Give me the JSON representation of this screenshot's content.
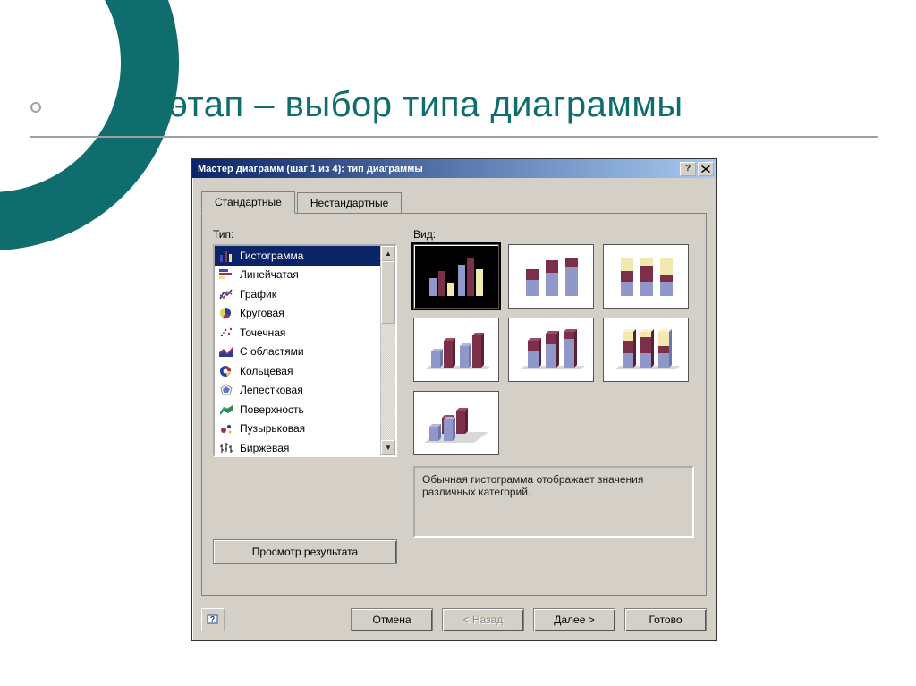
{
  "slide": {
    "title": "1 этап – выбор типа диаграммы"
  },
  "dialog": {
    "title": "Мастер диаграмм (шаг 1 из 4): тип диаграммы",
    "tabs": {
      "standard": "Стандартные",
      "custom": "Нестандартные"
    },
    "labels": {
      "type": "Тип:",
      "view": "Вид:"
    },
    "preview_btn": "Просмотр результата",
    "description": "Обычная гистограмма отображает значения различных категорий.",
    "types": [
      {
        "label": "Гистограмма",
        "icon": "bar"
      },
      {
        "label": "Линейчатая",
        "icon": "hbar"
      },
      {
        "label": "График",
        "icon": "line"
      },
      {
        "label": "Круговая",
        "icon": "pie"
      },
      {
        "label": "Точечная",
        "icon": "scatter"
      },
      {
        "label": "С областями",
        "icon": "area"
      },
      {
        "label": "Кольцевая",
        "icon": "donut"
      },
      {
        "label": "Лепестковая",
        "icon": "radar"
      },
      {
        "label": "Поверхность",
        "icon": "surface"
      },
      {
        "label": "Пузырьковая",
        "icon": "bubble"
      },
      {
        "label": "Биржевая",
        "icon": "stock"
      }
    ],
    "selected_type_index": 0,
    "buttons": {
      "cancel": "Отмена",
      "back": "< Назад",
      "next": "Далее >",
      "finish": "Готово"
    }
  },
  "colors": {
    "accent": "#0f6d6e",
    "sel_bg": "#0b2468",
    "bar1": "#8f98c9",
    "bar2": "#7b2f49",
    "bar3": "#f1e9b0"
  }
}
